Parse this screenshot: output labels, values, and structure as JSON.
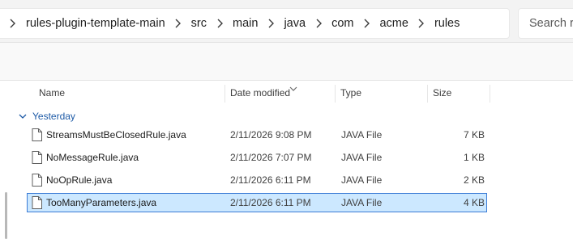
{
  "breadcrumb": [
    "rules-plugin-template-main",
    "src",
    "main",
    "java",
    "com",
    "acme",
    "rules"
  ],
  "search": {
    "placeholder": "Search rules"
  },
  "columns": {
    "name": "Name",
    "date_modified": "Date modified",
    "type": "Type",
    "size": "Size"
  },
  "group": {
    "label": "Yesterday"
  },
  "files": [
    {
      "name": "StreamsMustBeClosedRule.java",
      "date_modified": "2/11/2026 9:08 PM",
      "type": "JAVA File",
      "size": "7 KB"
    },
    {
      "name": "NoMessageRule.java",
      "date_modified": "2/11/2026 7:07 PM",
      "type": "JAVA File",
      "size": "1 KB"
    },
    {
      "name": "NoOpRule.java",
      "date_modified": "2/11/2026 6:11 PM",
      "type": "JAVA File",
      "size": "2 KB"
    },
    {
      "name": "TooManyParameters.java",
      "date_modified": "2/11/2026 6:11 PM",
      "type": "JAVA File",
      "size": "4 KB",
      "selected": true
    }
  ],
  "colors": {
    "selection_bg": "#cce8ff",
    "selection_border": "#3a7bd5",
    "group_text": "#1d5aa6"
  },
  "icons": {
    "separator": "chevron-right-icon",
    "file": "file-icon",
    "group_toggle": "chevron-down-icon",
    "sort": "sort-caret-icon"
  }
}
